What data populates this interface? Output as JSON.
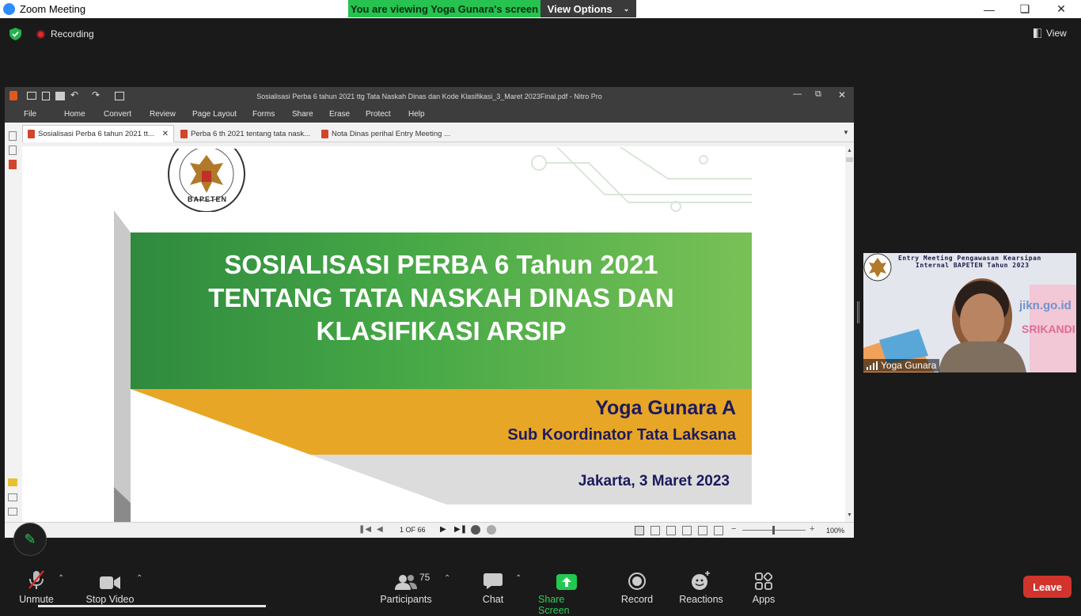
{
  "zoom": {
    "window_title": "Zoom Meeting",
    "banner_text": "You are viewing Yoga Gunara's screen",
    "view_options_label": "View Options",
    "recording_label": "Recording",
    "view_label": "View",
    "participants_count": "75",
    "toolbar": {
      "unmute": "Unmute",
      "stop_video": "Stop Video",
      "participants": "Participants",
      "chat": "Chat",
      "share_screen": "Share Screen",
      "record": "Record",
      "reactions": "Reactions",
      "apps": "Apps",
      "leave": "Leave"
    },
    "video_participant_name": "Yoga Gunara",
    "video_overlay_title_1": "Entry Meeting Pengawasan Kearsipan",
    "video_overlay_title_2": "Internal BAPETEN Tahun 2023",
    "video_overlay_site": "jikn.go.id",
    "video_overlay_brand": "SRIKANDI"
  },
  "nitro": {
    "window_title": "Sosialisasi Perba 6 tahun 2021 ttg Tata Naskah Dinas dan Kode Klasifikasi_3_Maret 2023Final.pdf - Nitro Pro",
    "menu": [
      "File",
      "Home",
      "Convert",
      "Review",
      "Page Layout",
      "Forms",
      "Share",
      "Erase",
      "Protect",
      "Help"
    ],
    "tabs": [
      "Sosialisasi Perba 6 tahun 2021 tt...",
      "Perba 6 th 2021 tentang tata nask...",
      "Nota Dinas perihal Entry Meeting ..."
    ],
    "page_indicator": "1 OF 66",
    "zoom_level": "100%"
  },
  "slide": {
    "logo_text": "BAPETEN",
    "title_lines": [
      "SOSIALISASI PERBA 6 Tahun 2021",
      "TENTANG TATA NASKAH DINAS DAN",
      "KLASIFIKASI ARSIP"
    ],
    "presenter": "Yoga Gunara A",
    "role": "Sub Koordinator Tata Laksana",
    "date": "Jakarta, 3 Maret 2023"
  }
}
